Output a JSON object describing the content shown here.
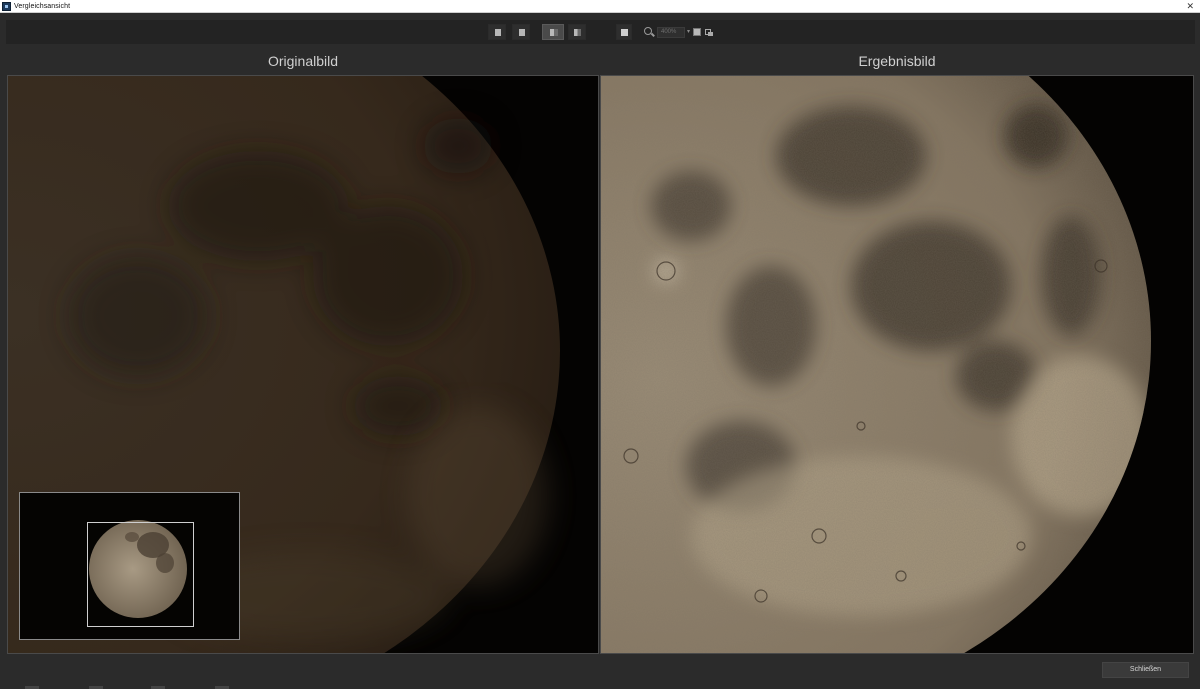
{
  "window": {
    "title": "Vergleichsansicht",
    "close_glyph": "✕"
  },
  "toolbar": {
    "buttons": [
      {
        "name": "view-single-original",
        "icon": "single-view-icon"
      },
      {
        "name": "view-single-result",
        "icon": "single-view-icon"
      },
      {
        "name": "view-split-vertical",
        "icon": "split-view-icon",
        "active": true
      },
      {
        "name": "view-split-horizontal",
        "icon": "split-view-icon"
      },
      {
        "name": "view-side-by-side",
        "icon": "side-by-side-icon"
      }
    ],
    "zoom_icon": "magnifier-icon",
    "zoom_value": "400%",
    "zoom_dropdown_glyph": "▾",
    "fit_icon": "fit-to-window-icon",
    "actual_size_icon": "actual-size-icon"
  },
  "panels": {
    "left_title": "Originalbild",
    "right_title": "Ergebnisbild"
  },
  "navigator": {
    "icon": "moon-thumbnail"
  },
  "footer": {
    "close_label": "Schließen"
  },
  "colors": {
    "background": "#2b2b2b",
    "toolbar": "#232323",
    "original_moon": "#3a3023",
    "result_moon": "#8a7c68"
  }
}
